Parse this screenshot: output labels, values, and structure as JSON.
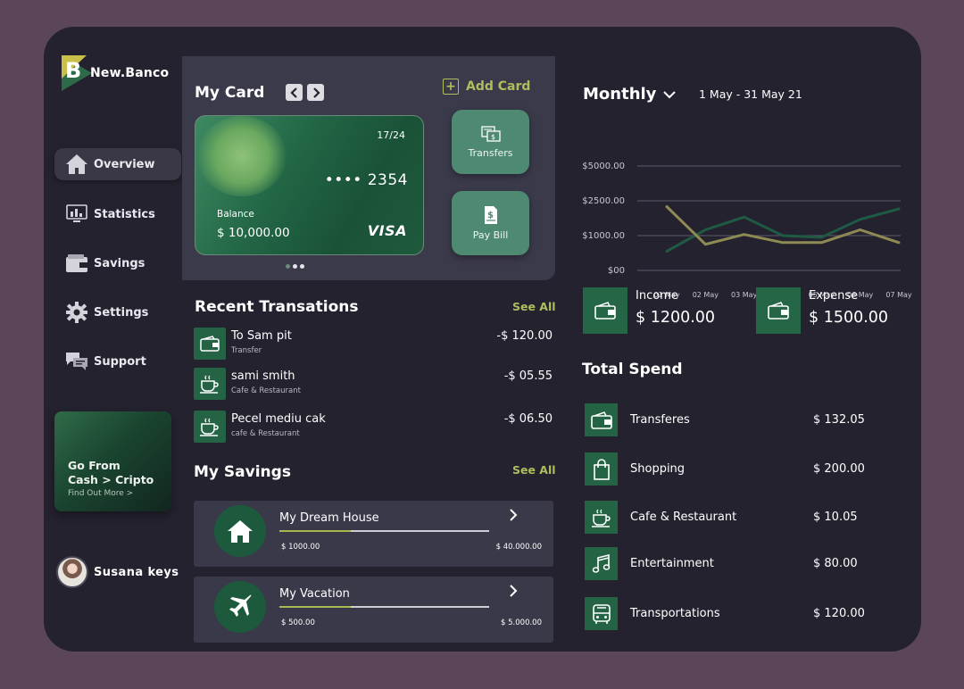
{
  "brand": {
    "name": "New.Banco",
    "logo_letter": "B"
  },
  "sidebar": {
    "items": [
      {
        "label": "Overview",
        "icon": "home-icon",
        "active": true
      },
      {
        "label": "Statistics",
        "icon": "monitor-chart-icon",
        "active": false
      },
      {
        "label": "Savings",
        "icon": "wallet-icon",
        "active": false
      },
      {
        "label": "Settings",
        "icon": "gear-icon",
        "active": false
      },
      {
        "label": "Support",
        "icon": "chat-bubbles-icon",
        "active": false
      }
    ],
    "promo": {
      "line1": "Go From",
      "line2": "Cash > Cripto",
      "link": "Find Out More >"
    },
    "user": {
      "name": "Susana  keys"
    }
  },
  "my_card": {
    "title": "My Card",
    "add_card_label": "Add Card",
    "card": {
      "expiry": "17/24",
      "number": "•••• 2354",
      "balance_label": "Balance",
      "balance": "$ 10,000.00",
      "network": "VISA"
    },
    "actions": [
      {
        "label": "Transfers",
        "icon": "transfer-icon"
      },
      {
        "label": "Pay Bill",
        "icon": "bill-icon"
      }
    ]
  },
  "recent_transactions": {
    "title": "Recent Transations",
    "see_all": "See All",
    "items": [
      {
        "name": "To Sam pit",
        "category": "Transfer",
        "amount": "-$ 120.00",
        "icon": "wallet-icon"
      },
      {
        "name": "sami smith",
        "category": "Cafe & Restaurant",
        "amount": "-$ 05.55",
        "icon": "coffee-icon"
      },
      {
        "name": "Pecel mediu cak",
        "category": "cafe & Restaurant",
        "amount": "-$ 06.50",
        "icon": "coffee-icon"
      }
    ]
  },
  "my_savings": {
    "title": "My Savings",
    "see_all": "See All",
    "items": [
      {
        "name": "My Dream House",
        "current": "$ 1000.00",
        "goal": "$ 40.000.00",
        "progress": 0.34,
        "icon": "house-icon"
      },
      {
        "name": "My Vacation",
        "current": "$ 500.00",
        "goal": "$ 5.000.00",
        "progress": 0.34,
        "icon": "airplane-icon"
      }
    ]
  },
  "overview": {
    "period_label": "Monthly",
    "date_range": "1 May - 31 May 21",
    "income": {
      "label": "Income",
      "value": "$ 1200.00"
    },
    "expense": {
      "label": "Expense",
      "value": "$ 1500.00"
    }
  },
  "chart_data": {
    "type": "line",
    "x": [
      "01 May",
      "02 May",
      "03 May",
      "04 May",
      "05 May",
      "06 May",
      "07 May"
    ],
    "y_ticks": [
      "$00",
      "$1000.00",
      "$2500.00",
      "$5000.00"
    ],
    "series": [
      {
        "color": "#1f5a45",
        "values": [
          550,
          1250,
          1800,
          1000,
          950,
          1700,
          2150
        ]
      },
      {
        "color": "#8e8a54",
        "values": [
          2250,
          750,
          1050,
          800,
          800,
          1250,
          800
        ]
      }
    ],
    "grid": true
  },
  "total_spend": {
    "title": "Total Spend",
    "items": [
      {
        "name": "Transferes",
        "amount": "$ 132.05",
        "icon": "wallet-icon"
      },
      {
        "name": "Shopping",
        "amount": "$ 200.00",
        "icon": "shopping-bag-icon"
      },
      {
        "name": "Cafe & Restaurant",
        "amount": "$ 10.05",
        "icon": "coffee-icon"
      },
      {
        "name": "Entertainment",
        "amount": "$ 80.00",
        "icon": "music-note-icon"
      },
      {
        "name": "Transportations",
        "amount": "$ 120.00",
        "icon": "bus-icon"
      }
    ]
  }
}
